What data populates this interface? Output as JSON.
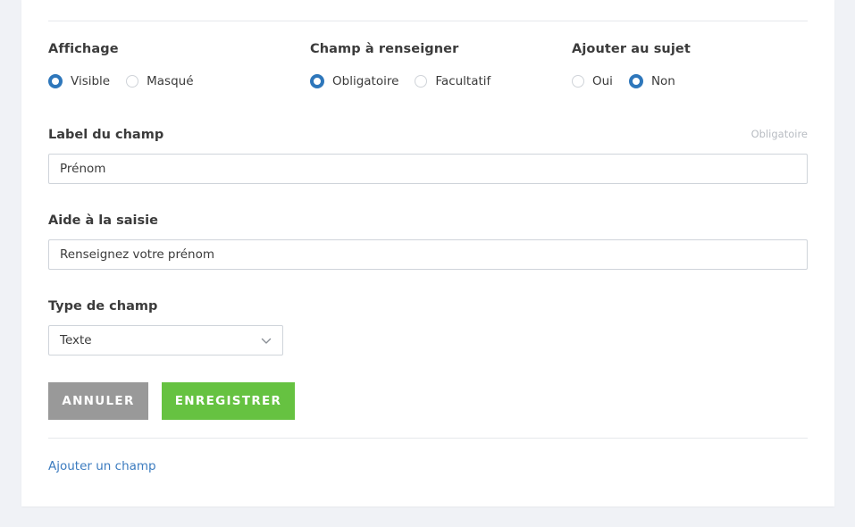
{
  "form": {
    "display": {
      "title": "Affichage",
      "options": [
        "Visible",
        "Masqué"
      ],
      "selected": "Visible"
    },
    "field_requirement": {
      "title": "Champ à renseigner",
      "options": [
        "Obligatoire",
        "Facultatif"
      ],
      "selected": "Obligatoire"
    },
    "add_to_subject": {
      "title": "Ajouter au sujet",
      "options": [
        "Oui",
        "Non"
      ],
      "selected": "Non"
    },
    "field_label": {
      "label": "Label du champ",
      "required_hint": "Obligatoire",
      "value": "Prénom"
    },
    "input_help": {
      "label": "Aide à la saisie",
      "value": "Renseignez votre prénom"
    },
    "field_type": {
      "label": "Type de champ",
      "selected": "Texte"
    },
    "buttons": {
      "cancel": "ANNULER",
      "save": "ENREGISTRER"
    },
    "add_field_link": "Ajouter un champ"
  },
  "colors": {
    "accent_blue": "#2e77bb",
    "link_blue": "#3b7bbf",
    "save_green": "#66c241",
    "cancel_gray": "#999999"
  },
  "icons": {
    "select_arrow": "chevron-down-icon"
  }
}
